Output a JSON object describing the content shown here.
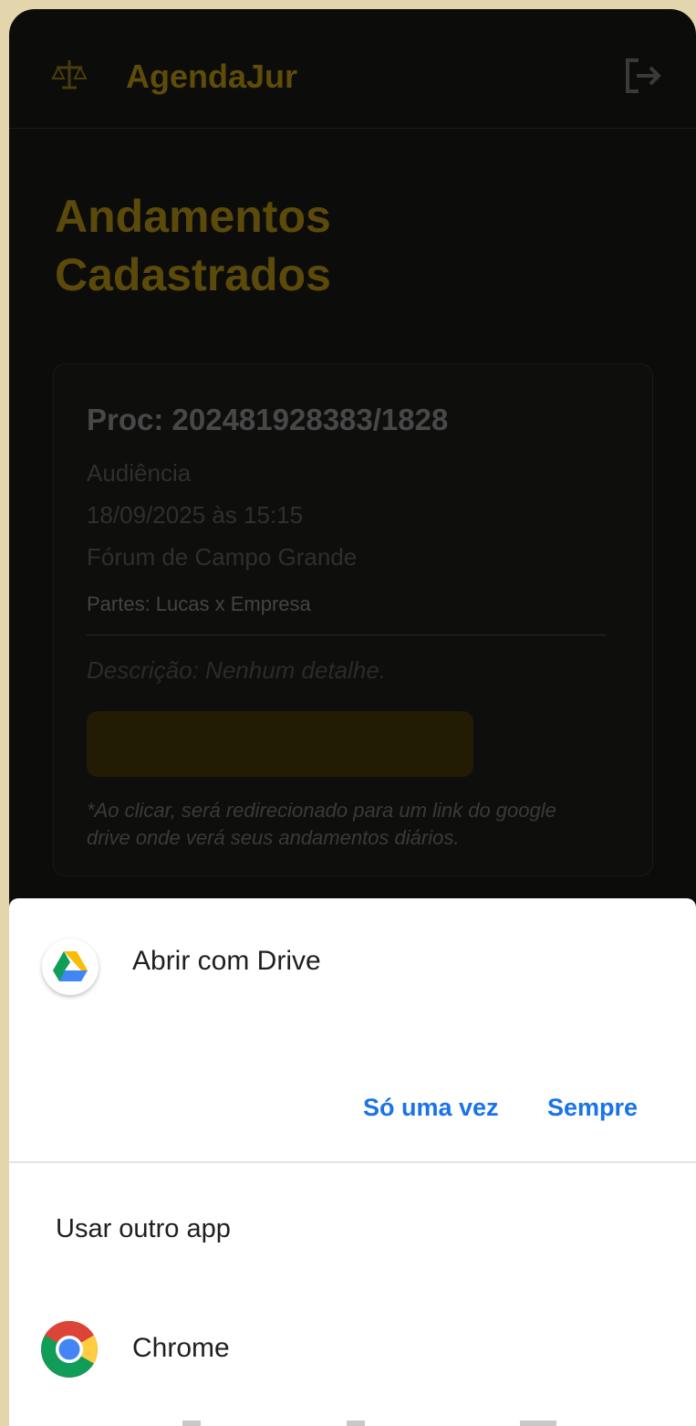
{
  "app": {
    "name": "AgendaJur",
    "page_title": "Andamentos Cadastrados"
  },
  "card": {
    "proc": "Proc: 202481928383/1828",
    "type": "Audiência",
    "datetime": "18/09/2025 às 15:15",
    "location": "Fórum de Campo Grande",
    "partes": "Partes: Lucas x Empresa",
    "descricao": "Descrição: Nenhum detalhe.",
    "note": "*Ao clicar, será redirecionado para um link do google drive onde verá seus andamentos diários."
  },
  "sheet": {
    "title": "Abrir com Drive",
    "once_label": "Só uma vez",
    "always_label": "Sempre",
    "other_app_label": "Usar outro app",
    "apps": [
      {
        "name": "Chrome",
        "icon": "chrome-icon"
      }
    ]
  },
  "icons": {
    "logo": "scales-of-justice-icon",
    "logout": "logout-icon",
    "drive": "google-drive-icon"
  },
  "colors": {
    "accent_dimmed": "#5e4c08",
    "link_blue": "#1a73e8",
    "backdrop": "#0c0c0b",
    "frame": "#e3d6ad"
  }
}
